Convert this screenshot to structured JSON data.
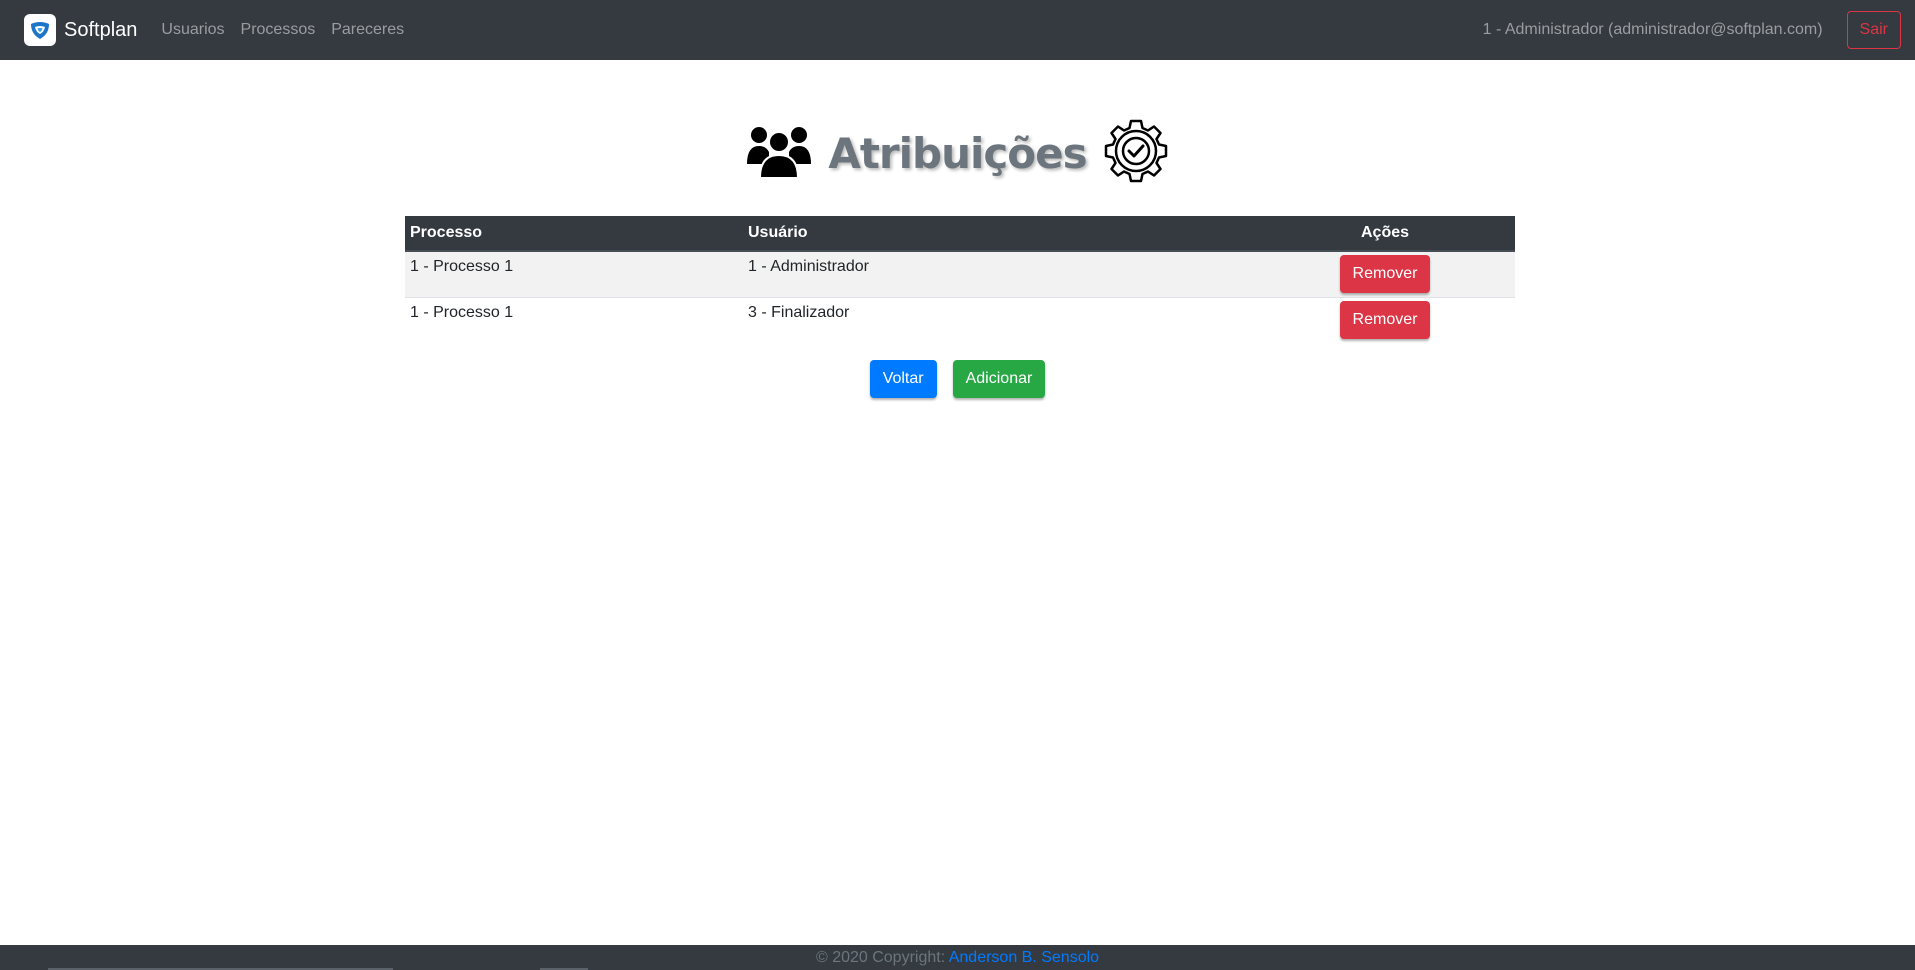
{
  "navbar": {
    "brand": "Softplan",
    "links": [
      "Usuarios",
      "Processos",
      "Pareceres"
    ],
    "user": "1 - Administrador (administrador@softplan.com)",
    "logout": "Sair",
    "accent": "#dc3545"
  },
  "page": {
    "title": "Atribuições",
    "icons": [
      "users-icon",
      "gear-check-icon"
    ]
  },
  "table": {
    "headers": [
      "Processo",
      "Usuário",
      "Ações"
    ],
    "rows": [
      {
        "processo": "1 - Processo 1",
        "usuario": "1 - Administrador",
        "action": "Remover"
      },
      {
        "processo": "1 - Processo 1",
        "usuario": "3 - Finalizador",
        "action": "Remover"
      }
    ]
  },
  "buttons": {
    "back": "Voltar",
    "add": "Adicionar"
  },
  "footer": {
    "copyright": "© 2020 Copyright:",
    "author": "Anderson B. Sensolo"
  }
}
